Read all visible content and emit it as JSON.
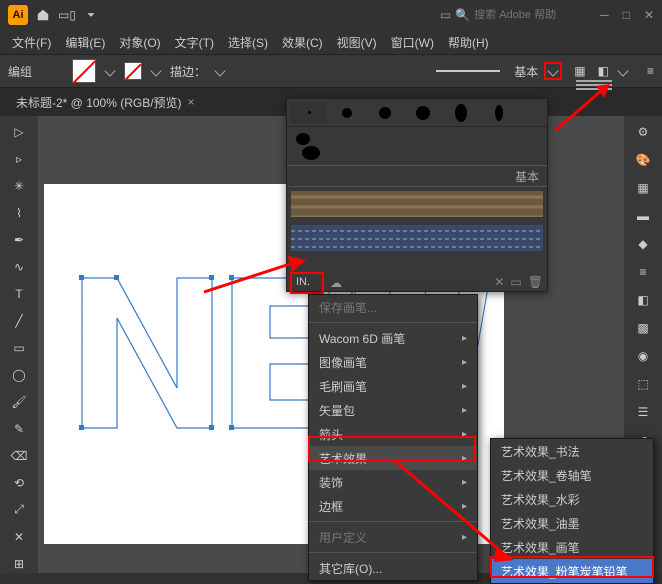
{
  "titlebar": {
    "search_placeholder": "搜索 Adobe 帮助",
    "logo": "Ai"
  },
  "menubar": {
    "file": "文件(F)",
    "edit": "编辑(E)",
    "object": "对象(O)",
    "type": "文字(T)",
    "select": "选择(S)",
    "effect": "效果(C)",
    "view": "视图(V)",
    "window": "窗口(W)",
    "help": "帮助(H)"
  },
  "controlbar": {
    "mode": "编组",
    "stroke_label": "描边：",
    "stroke_label2": "基本"
  },
  "doc": {
    "tab_title": "未标题-2* @ 100% (RGB/预览)"
  },
  "brush_panel": {
    "basic": "基本"
  },
  "menu1": {
    "save": "保存画笔...",
    "wacom": "Wacom 6D 画笔",
    "image": "图像画笔",
    "bristle": "毛刷画笔",
    "vector": "矢量包",
    "arrows": "箭头",
    "art": "艺术效果",
    "decor": "装饰",
    "border": "边框",
    "userdef": "用户定义",
    "other": "其它库(O)..."
  },
  "menu2": {
    "calli": "艺术效果_书法",
    "scroll": "艺术效果_卷轴笔",
    "water": "艺术效果_水彩",
    "ink": "艺术效果_油墨",
    "paint": "艺术效果_画笔",
    "chalk": "艺术效果_粉笔炭笔铅笔"
  }
}
